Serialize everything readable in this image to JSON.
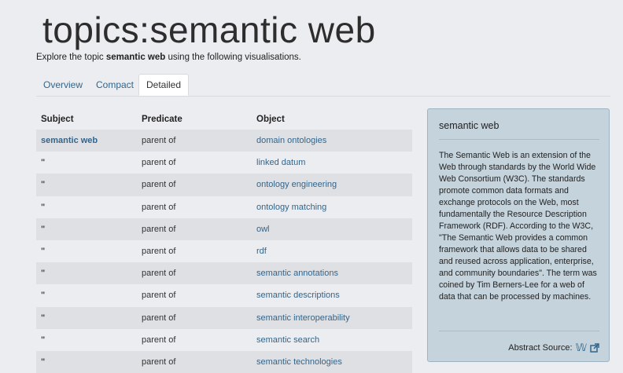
{
  "header": {
    "title": "topics:semantic web",
    "intro_prefix": "Explore the topic ",
    "intro_topic": "semantic web",
    "intro_suffix": " using the following visualisations."
  },
  "tabs": [
    {
      "label": "Overview",
      "active": false
    },
    {
      "label": "Compact",
      "active": false
    },
    {
      "label": "Detailed",
      "active": true
    }
  ],
  "table": {
    "columns": [
      "Subject",
      "Predicate",
      "Object"
    ],
    "rows": [
      {
        "subject": "semantic web",
        "predicate": "parent of",
        "object": "domain ontologies"
      },
      {
        "subject": "\"",
        "predicate": "parent of",
        "object": "linked datum"
      },
      {
        "subject": "\"",
        "predicate": "parent of",
        "object": "ontology engineering"
      },
      {
        "subject": "\"",
        "predicate": "parent of",
        "object": "ontology matching"
      },
      {
        "subject": "\"",
        "predicate": "parent of",
        "object": "owl"
      },
      {
        "subject": "\"",
        "predicate": "parent of",
        "object": "rdf"
      },
      {
        "subject": "\"",
        "predicate": "parent of",
        "object": "semantic annotations"
      },
      {
        "subject": "\"",
        "predicate": "parent of",
        "object": "semantic descriptions"
      },
      {
        "subject": "\"",
        "predicate": "parent of",
        "object": "semantic interoperability"
      },
      {
        "subject": "\"",
        "predicate": "parent of",
        "object": "semantic search"
      },
      {
        "subject": "\"",
        "predicate": "parent of",
        "object": "semantic technologies"
      }
    ]
  },
  "panel": {
    "title": "semantic web",
    "abstract": "The Semantic Web is an extension of the Web through standards by the World Wide Web Consortium (W3C). The standards promote common data formats and exchange protocols on the Web, most fundamentally the Resource Description Framework (RDF). According to the W3C, \"The Semantic Web provides a common framework that allows data to be shared and reused across application, enterprise, and community boundaries\". The term was coined by Tim Berners-Lee for a web of data that can be processed by machines.",
    "source_label": "Abstract Source:",
    "source_icon": "wikipedia-icon",
    "external_icon": "external-link-icon"
  },
  "colors": {
    "link": "#33658a",
    "panel_bg": "#c4d3dc",
    "stripe": "#dfe0e4",
    "page_bg": "#ecedf0"
  }
}
